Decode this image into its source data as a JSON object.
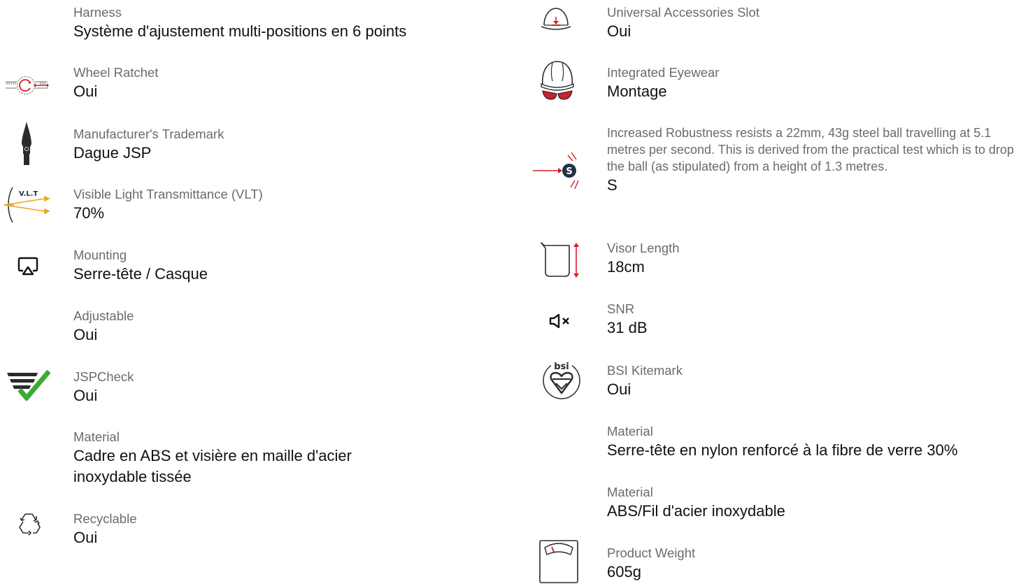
{
  "left_specs": [
    {
      "label": "Harness",
      "value": "Système d'ajustement multi-positions en 6 points",
      "icon": ""
    },
    {
      "label": "Wheel Ratchet",
      "value": "Oui",
      "icon": "wheel-ratchet-icon"
    },
    {
      "label": "Manufacturer's Trademark",
      "value": "Dague JSP",
      "icon": "dagger-trademark-icon"
    },
    {
      "label": "Visible Light Transmittance (VLT)",
      "value": "70%",
      "icon": "vlt-icon",
      "icon_text": "V.L.T"
    },
    {
      "label": "Mounting",
      "value": "Serre-tête / Casque",
      "icon": "mounting-icon"
    },
    {
      "label": "Adjustable",
      "value": "Oui",
      "icon": ""
    },
    {
      "label": "JSPCheck",
      "value": "Oui",
      "icon": "jspcheck-icon"
    },
    {
      "label": "Material",
      "value": "Cadre en ABS et visière en maille d'acier inoxydable tissée",
      "icon": ""
    },
    {
      "label": "Recyclable",
      "value": "Oui",
      "icon": "recycle-icon"
    }
  ],
  "right_specs": [
    {
      "label": "Universal Accessories Slot",
      "value": "Oui",
      "icon": "accessory-slot-helmet-icon"
    },
    {
      "label": "Integrated Eyewear",
      "value": "Montage",
      "icon": "integrated-eyewear-helmet-icon"
    },
    {
      "label": "Increased Robustness resists a 22mm, 43g steel ball travelling at 5.1 metres per second. This is derived from the practical test which is to drop the ball (as stipulated) from a height of 1.3 metres.",
      "value": "S",
      "icon": "robustness-s-icon",
      "icon_text": "S"
    },
    {
      "label": "Visor Length",
      "value": "18cm",
      "icon": "visor-length-icon"
    },
    {
      "label": "SNR",
      "value": "31 dB",
      "icon": "snr-speaker-icon"
    },
    {
      "label": "BSI Kitemark",
      "value": "Oui",
      "icon": "bsi-kitemark-icon",
      "icon_text": "bsi"
    },
    {
      "label": "Material",
      "value": "Serre-tête en nylon renforcé à la fibre de verre 30%",
      "icon": ""
    },
    {
      "label": "Material",
      "value": "ABS/Fil d'acier inoxydable",
      "icon": ""
    },
    {
      "label": "Product Weight",
      "value": "605g",
      "icon": "weight-scale-icon"
    }
  ],
  "colors": {
    "label": "#6b6b6b",
    "value": "#111111",
    "accent_red": "#d0202a",
    "accent_green": "#3aaa35",
    "accent_orange": "#f0a020",
    "icon_dark": "#2b2b2b",
    "icon_navy": "#1f3347"
  }
}
